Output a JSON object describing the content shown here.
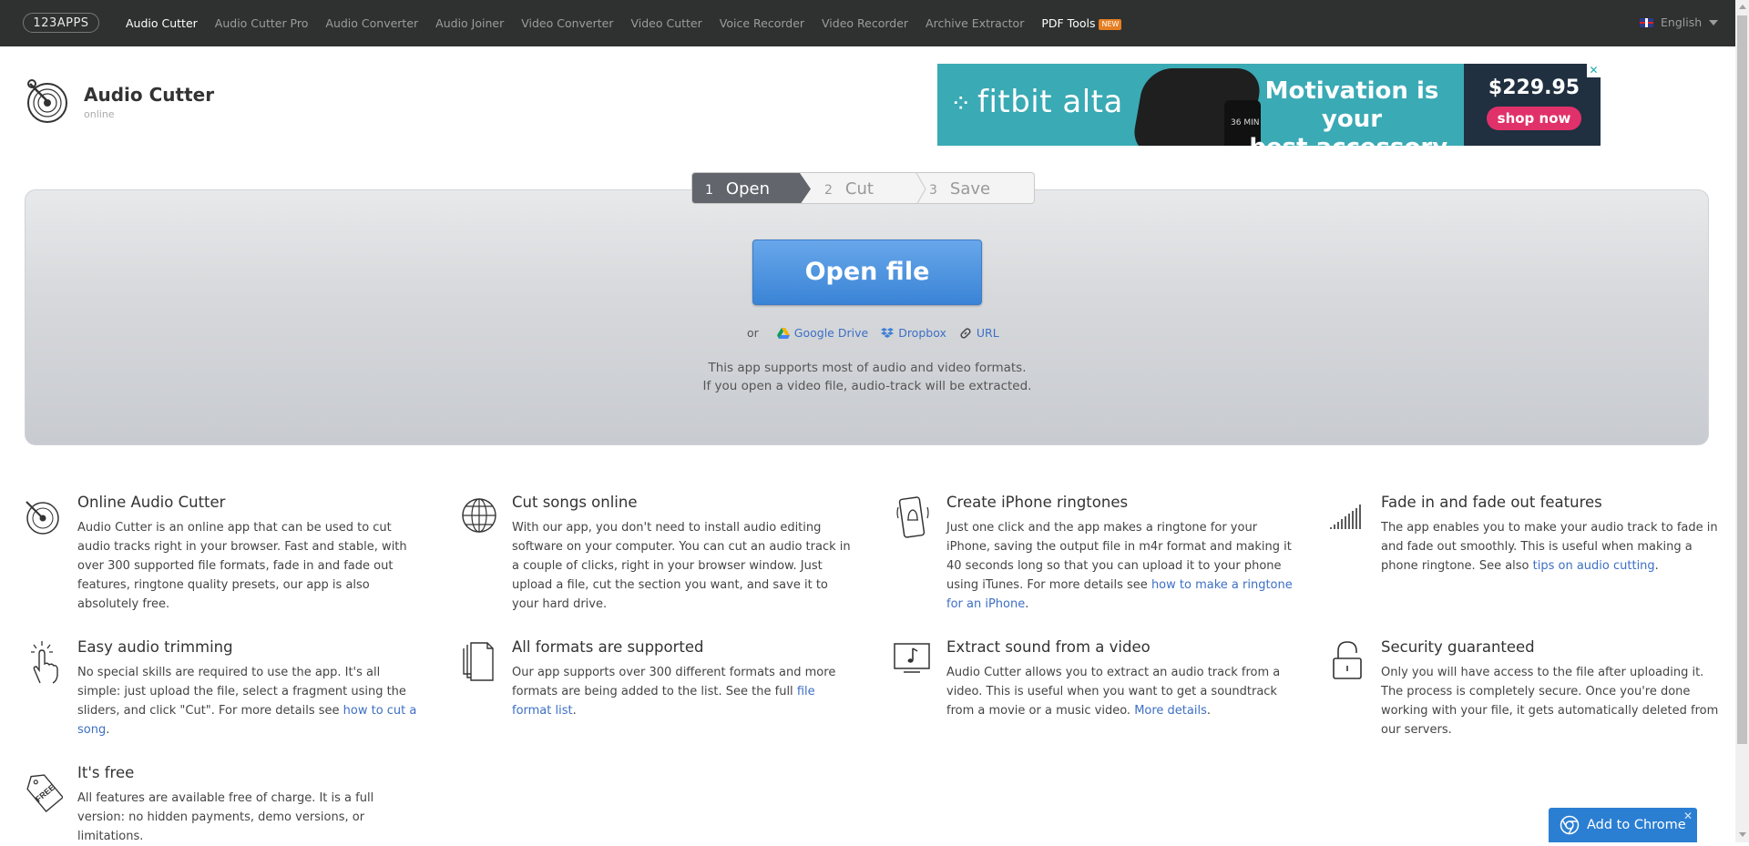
{
  "nav": {
    "logo": "123APPS",
    "items": [
      "Audio Cutter",
      "Audio Cutter Pro",
      "Audio Converter",
      "Audio Joiner",
      "Video Converter",
      "Video Cutter",
      "Voice Recorder",
      "Video Recorder",
      "Archive Extractor"
    ],
    "pdf_tools": "PDF Tools",
    "new_badge": "NEW",
    "language": "English"
  },
  "header": {
    "title": "Audio Cutter",
    "subtitle": "online"
  },
  "ad": {
    "brand": "fitbit alta",
    "slogan_line1": "Motivation is your",
    "slogan_line2": "best accessory.",
    "price": "$229.95",
    "button": "shop now",
    "band_display": "36 MIN"
  },
  "steps": [
    {
      "num": "1",
      "label": "Open"
    },
    {
      "num": "2",
      "label": "Cut"
    },
    {
      "num": "3",
      "label": "Save"
    }
  ],
  "main": {
    "open_button": "Open file",
    "or": "or",
    "google_drive": "Google Drive",
    "dropbox": "Dropbox",
    "url": "URL",
    "support_line1": "This app supports most of audio and video formats.",
    "support_line2": "If you open a video file, audio-track will be extracted."
  },
  "features": {
    "f1": {
      "title": "Online Audio Cutter",
      "text": "Audio Cutter is an online app that can be used to cut audio tracks right in your browser. Fast and stable, with over 300 supported file formats, fade in and fade out features, ringtone quality presets, our app is also absolutely free."
    },
    "f2": {
      "title": "Cut songs online",
      "text": "With our app, you don't need to install audio editing software on your computer. You can cut an audio track in a couple of clicks, right in your browser window. Just upload a file, cut the section you want, and save it to your hard drive."
    },
    "f3": {
      "title": "Create iPhone ringtones",
      "text_before": "Just one click and the app makes a ringtone for your iPhone, saving the output file in m4r format and making it 40 seconds long so that you can upload it to your phone using iTunes. For more details see ",
      "link": "how to make a ringtone for an iPhone",
      "text_after": "."
    },
    "f4": {
      "title": "Fade in and fade out features",
      "text_before": "The app enables you to make your audio track to fade in and fade out smoothly. This is useful when making a phone ringtone. See also ",
      "link": "tips on audio cutting",
      "text_after": "."
    },
    "f5": {
      "title": "Easy audio trimming",
      "text_before": "No special skills are required to use the app. It's all simple: just upload the file, select a fragment using the sliders, and click \"Cut\". For more details see ",
      "link": "how to cut a song",
      "text_after": "."
    },
    "f6": {
      "title": "All formats are supported",
      "text_before": "Our app supports over 300 different formats and more formats are being added to the list. See the full ",
      "link": "file format list",
      "text_after": "."
    },
    "f7": {
      "title": "Extract sound from a video",
      "text_before": "Audio Cutter allows you to extract an audio track from a video. This is useful when you want to get a soundtrack from a movie or a music video. ",
      "link": "More details",
      "text_after": "."
    },
    "f8": {
      "title": "Security guaranteed",
      "text": "Only you will have access to the file after uploading it. The process is completely secure. Once you're done working with your file, it gets automatically deleted from our servers."
    },
    "f9": {
      "title": "It's free",
      "text": "All features are available free of charge. It is a full version: no hidden payments, demo versions, or limitations.",
      "icon_text": "FREE"
    }
  },
  "chrome_banner": {
    "label": "Add to Chrome"
  }
}
